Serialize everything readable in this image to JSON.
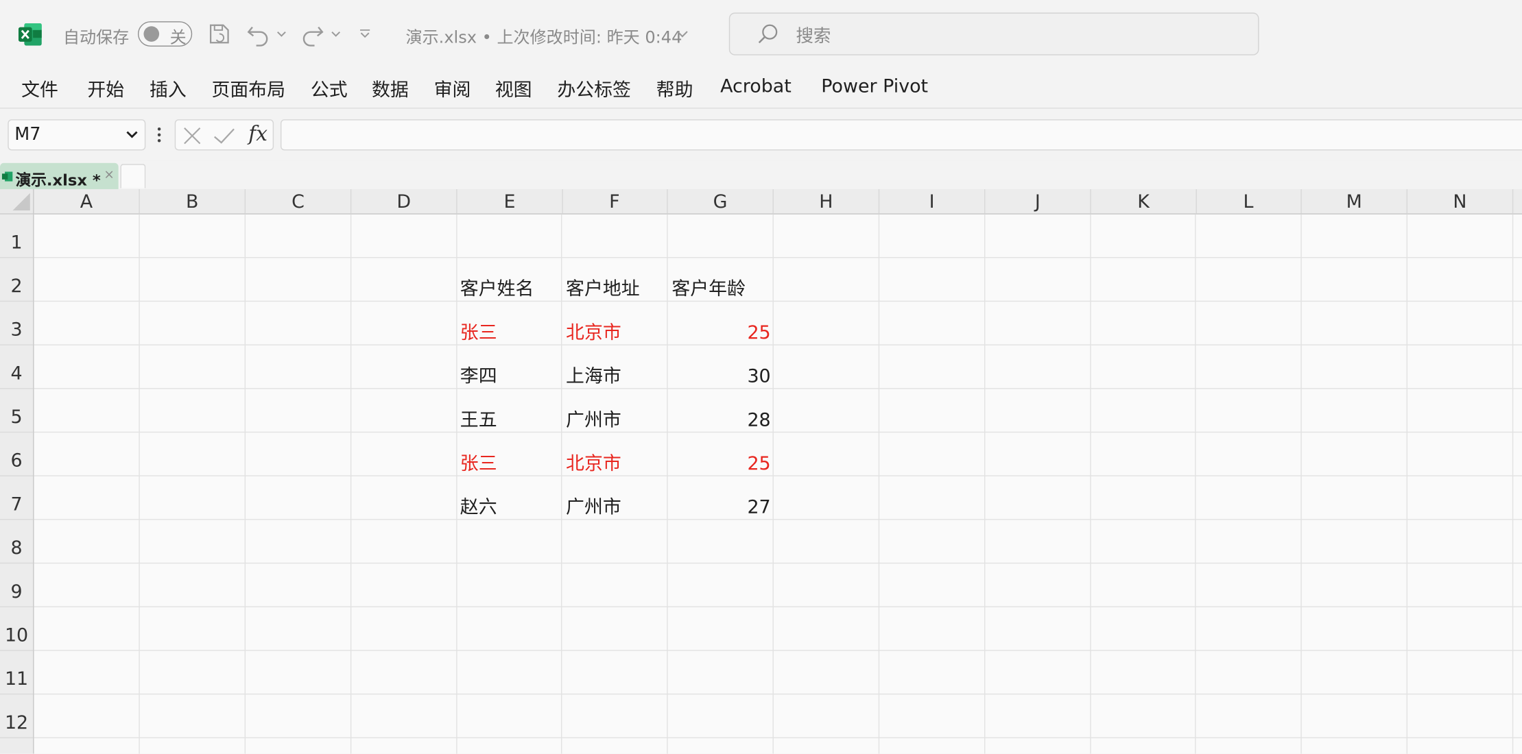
{
  "titlebar": {
    "autosave_label": "自动保存",
    "autosave_state": "关",
    "doc_title": "演示.xlsx • 上次修改时间: 昨天 0:44",
    "search_placeholder": "搜索"
  },
  "ribbon": {
    "tabs": [
      "文件",
      "开始",
      "插入",
      "页面布局",
      "公式",
      "数据",
      "审阅",
      "视图",
      "办公标签",
      "帮助",
      "Acrobat",
      "Power Pivot"
    ]
  },
  "formula_bar": {
    "name_box": "M7",
    "fx_label": "fx",
    "formula": ""
  },
  "workbook_tab": {
    "name": "演示.xlsx *",
    "close": "×"
  },
  "grid": {
    "columns": [
      "A",
      "B",
      "C",
      "D",
      "E",
      "F",
      "G",
      "H",
      "I",
      "J",
      "K",
      "L",
      "M",
      "N"
    ],
    "rows": [
      "1",
      "2",
      "3",
      "4",
      "5",
      "6",
      "7",
      "8",
      "9",
      "10",
      "11",
      "12"
    ],
    "headers": {
      "E2": "客户姓名",
      "F2": "客户地址",
      "G2": "客户年龄"
    },
    "records": [
      {
        "row": "3",
        "name": "张三",
        "address": "北京市",
        "age": "25",
        "highlight": true
      },
      {
        "row": "4",
        "name": "李四",
        "address": "上海市",
        "age": "30",
        "highlight": false
      },
      {
        "row": "5",
        "name": "王五",
        "address": "广州市",
        "age": "28",
        "highlight": false
      },
      {
        "row": "6",
        "name": "张三",
        "address": "北京市",
        "age": "25",
        "highlight": true
      },
      {
        "row": "7",
        "name": "赵六",
        "address": "广州市",
        "age": "27",
        "highlight": false
      }
    ]
  },
  "colors": {
    "excel_green": "#107c41",
    "duplicate_red": "#e8261f",
    "tab_green": "#c6e1cf"
  }
}
